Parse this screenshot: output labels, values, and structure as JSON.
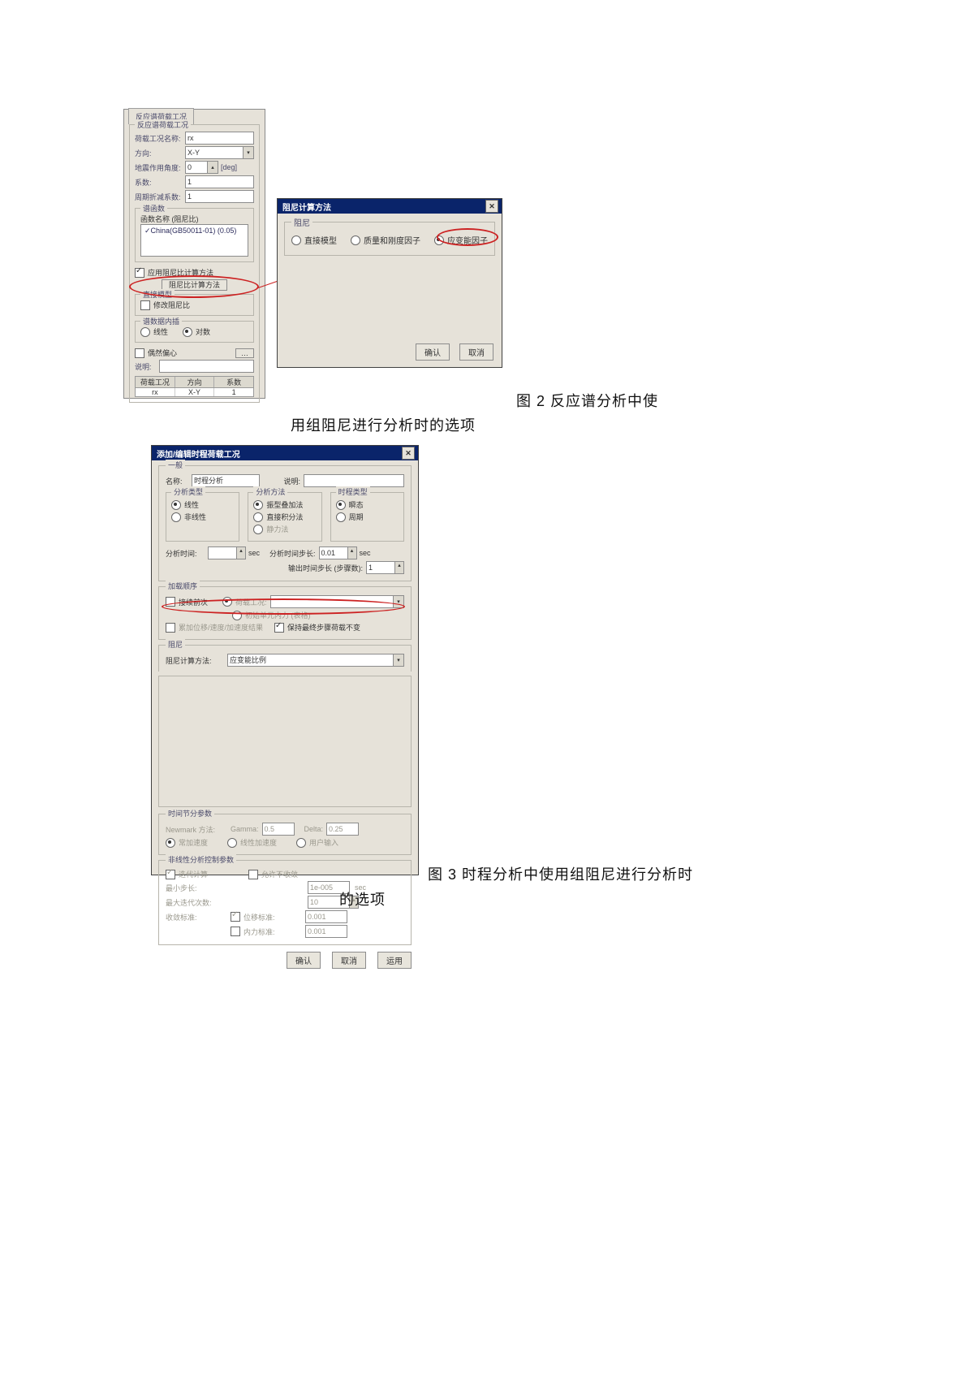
{
  "caption2_a": "图 2 反应谱分析中使",
  "caption2_b": "用组阻尼进行分析时的选项",
  "caption3_a": "图 3 时程分析中使用组阻尼进行分析时",
  "caption3_b": "的选项",
  "fig1": {
    "tab": "反应谱荷载工况",
    "group_title": "反应谱荷载工况",
    "rows": {
      "name_lbl": "荷载工况名称:",
      "name_val": "rx",
      "dir_lbl": "方向:",
      "dir_val": "X-Y",
      "angle_lbl": "地震作用角度:",
      "angle_val": "0",
      "angle_unit": "[deg]",
      "factor_lbl": "系数:",
      "factor_val": "1",
      "period_lbl": "周期折减系数:",
      "period_val": "1"
    },
    "funcs": {
      "title": "谱函数",
      "sub": "函数名称 (阻尼比)",
      "item": "✓China(GB50011-01) (0.05)"
    },
    "apply_chk": "应用阻尼比计算方法",
    "method_btn": "阻尼比计算方法",
    "model_group": "直接模型",
    "modify_chk": "修改阻尼比",
    "combine": {
      "title": "谱数据内插",
      "opt1": "线性",
      "opt2": "对数"
    },
    "ecc_chk": "偶然偏心",
    "desc_lbl": "说明:",
    "cols": {
      "c1": "荷载工况",
      "c2": "方向",
      "c3": "系数"
    },
    "row": {
      "c1": "rx",
      "c2": "X-Y",
      "c3": "1"
    }
  },
  "popup": {
    "title": "阻尼计算方法",
    "group": "阻尼",
    "opt1": "直接模型",
    "opt2": "质量和刚度因子",
    "opt3": "应变能因子",
    "ok": "确认",
    "cancel": "取消"
  },
  "fig3": {
    "title": "添加/编辑时程荷载工况",
    "general": {
      "title": "一般",
      "name_lbl": "名称:",
      "name_val": "时程分析",
      "desc_lbl": "说明:"
    },
    "col1": {
      "title": "分析类型",
      "opt1": "线性",
      "opt2": "非线性"
    },
    "col2": {
      "title": "分析方法",
      "opt1": "振型叠加法",
      "opt2": "直接积分法",
      "opt3": "静力法"
    },
    "col3": {
      "title": "时程类型",
      "opt1": "瞬态",
      "opt2": "周期"
    },
    "time": {
      "total_lbl": "分析时间:",
      "total_unit": "sec",
      "dt_lbl": "分析时间步长:",
      "dt_val": "0.01",
      "dt_unit": "sec",
      "out_lbl": "输出时间步长 (步骤数):",
      "out_val": "1"
    },
    "order": {
      "title": "加载顺序",
      "chk": "接续前次",
      "r1": "荷载工况:",
      "r2": "初始单元内力 (表格)",
      "chk2": "累加位移/速度/加速度结果",
      "chk3": "保持最终步骤荷载不变"
    },
    "damp": {
      "title": "阻尼",
      "method_lbl": "阻尼计算方法:",
      "method_val": "应变能比例"
    },
    "tinc": {
      "title": "时间节分参数",
      "lbl1": "Newmark 方法:",
      "gamma": "Gamma:",
      "gamma_v": "0.5",
      "delta": "Delta:",
      "delta_v": "0.25",
      "r1": "常加速度",
      "r2": "线性加速度",
      "r3": "用户输入"
    },
    "nl": {
      "title": "非线性分析控制参数",
      "chk1": "迭代计算",
      "chk2": "允许不收敛",
      "r1": "最小步长:",
      "v1": "1e-005",
      "u1": "sec",
      "r2": "最大迭代次数:",
      "v2": "10",
      "r3": "收敛标准:",
      "c3a": "位移标准:",
      "v3a": "0.001",
      "c3b": "内力标准:",
      "v3b": "0.001"
    },
    "btns": {
      "ok": "确认",
      "cancel": "取消",
      "apply": "运用"
    }
  }
}
